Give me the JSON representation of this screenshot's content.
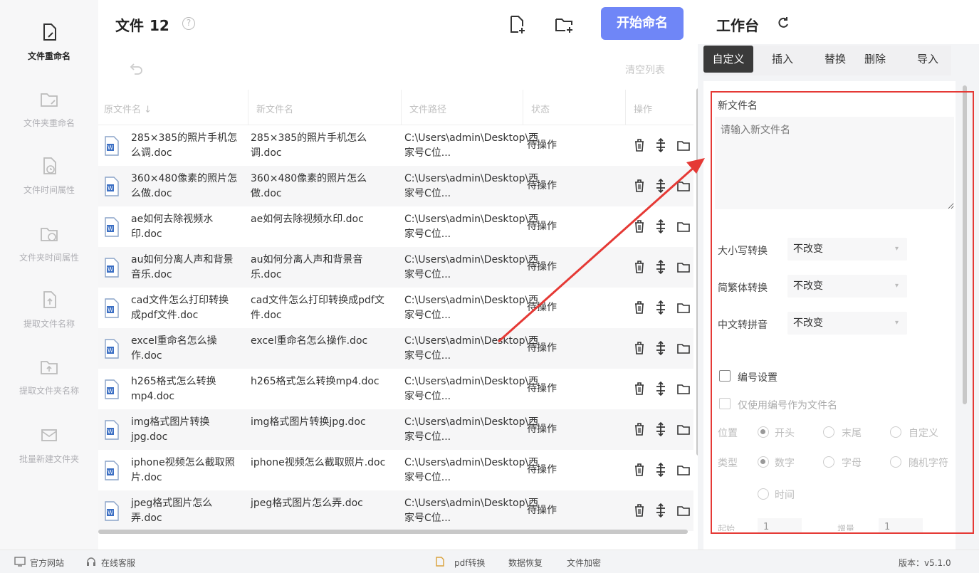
{
  "sidebar": {
    "items": [
      {
        "label": "文件重命名",
        "icon": "file-edit-icon",
        "active": true
      },
      {
        "label": "文件夹重命名",
        "icon": "folder-edit-icon",
        "active": false
      },
      {
        "label": "文件时间属性",
        "icon": "file-clock-icon",
        "active": false
      },
      {
        "label": "文件夹时间属性",
        "icon": "folder-clock-icon",
        "active": false
      },
      {
        "label": "提取文件名称",
        "icon": "file-upload-icon",
        "active": false
      },
      {
        "label": "提取文件夹名称",
        "icon": "folder-upload-icon",
        "active": false
      },
      {
        "label": "批量新建文件夹",
        "icon": "folder-mail-icon",
        "active": false
      }
    ]
  },
  "main": {
    "title": "文件",
    "count": "12",
    "help_icon": "?",
    "start_button": "开始命名",
    "clear_list": "清空列表",
    "columns": [
      "原文件名 ↓",
      "新文件名",
      "文件路径",
      "状态",
      "操作"
    ],
    "rows": [
      {
        "orig": "285×385的照片手机怎么调.doc",
        "new": "285×385的照片手机怎么调.doc",
        "path": "C:\\Users\\admin\\Desktop\\西家号C位...",
        "status": "待操作"
      },
      {
        "orig": "360×480像素的照片怎么做.doc",
        "new": "360×480像素的照片怎么做.doc",
        "path": "C:\\Users\\admin\\Desktop\\西家号C位...",
        "status": "待操作"
      },
      {
        "orig": "ae如何去除视频水印.doc",
        "new": "ae如何去除视频水印.doc",
        "path": "C:\\Users\\admin\\Desktop\\西家号C位...",
        "status": "待操作"
      },
      {
        "orig": "au如何分离人声和背景音乐.doc",
        "new": "au如何分离人声和背景音乐.doc",
        "path": "C:\\Users\\admin\\Desktop\\西家号C位...",
        "status": "待操作"
      },
      {
        "orig": "cad文件怎么打印转换成pdf文件.doc",
        "new": "cad文件怎么打印转换成pdf文件.doc",
        "path": "C:\\Users\\admin\\Desktop\\西家号C位...",
        "status": "待操作"
      },
      {
        "orig": "excel重命名怎么操作.doc",
        "new": "excel重命名怎么操作.doc",
        "path": "C:\\Users\\admin\\Desktop\\西家号C位...",
        "status": "待操作"
      },
      {
        "orig": "h265格式怎么转换mp4.doc",
        "new": "h265格式怎么转换mp4.doc",
        "path": "C:\\Users\\admin\\Desktop\\西家号C位...",
        "status": "待操作"
      },
      {
        "orig": "img格式图片转换jpg.doc",
        "new": "img格式图片转换jpg.doc",
        "path": "C:\\Users\\admin\\Desktop\\西家号C位...",
        "status": "待操作"
      },
      {
        "orig": "iphone视频怎么截取照片.doc",
        "new": "iphone视频怎么截取照片.doc",
        "path": "C:\\Users\\admin\\Desktop\\西家号C位...",
        "status": "待操作"
      },
      {
        "orig": "jpeg格式图片怎么弄.doc",
        "new": "jpeg格式图片怎么弄.doc",
        "path": "C:\\Users\\admin\\Desktop\\西家号C位...",
        "status": "待操作"
      }
    ]
  },
  "workbench": {
    "title": "工作台",
    "tabs": [
      "自定义",
      "插入",
      "替换",
      "删除",
      "导入"
    ],
    "new_name_label": "新文件名",
    "new_name_placeholder": "请输入新文件名",
    "case_label": "大小写转换",
    "case_value": "不改变",
    "trad_label": "简繁体转换",
    "trad_value": "不改变",
    "pinyin_label": "中文转拼音",
    "pinyin_value": "不改变",
    "numbering_label": "编号设置",
    "only_number_label": "仅使用编号作为文件名",
    "position_label": "位置",
    "position_options": [
      "开头",
      "末尾",
      "自定义"
    ],
    "type_label": "类型",
    "type_options": [
      "数字",
      "字母",
      "随机字符",
      "时间"
    ],
    "start_label": "起始",
    "start_value": "1",
    "step_label": "增量",
    "step_value": "1"
  },
  "footer": {
    "website": "官方网站",
    "service": "在线客服",
    "pdf": "pdf转换",
    "recover": "数据恢复",
    "encrypt": "文件加密",
    "version": "版本：v5.1.0"
  },
  "colors": {
    "accent": "#6f86f7",
    "annotation": "#e53935"
  }
}
